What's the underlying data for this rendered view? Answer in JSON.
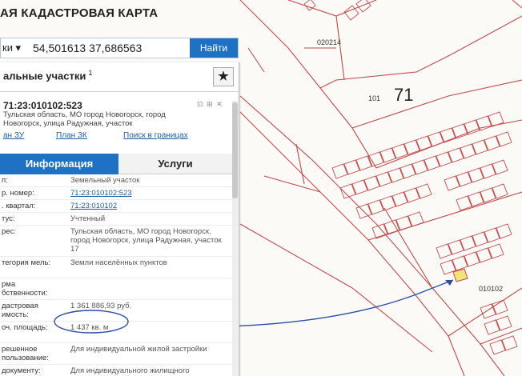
{
  "app": {
    "title": "АЯ КАДАСТРОВАЯ КАРТА"
  },
  "search": {
    "type_label": "ки ▾",
    "value": "54,501613 37,686563",
    "button_label": "Найти"
  },
  "panel": {
    "header_title": "альные участки",
    "header_sup": "1",
    "star_glyph": "★",
    "parcel_number": "71:23:010102:523",
    "tools_glyphs": "⊡ ⊞ ✕",
    "address": "Тульская область, МО город Новогорск, город Новогорск, улица Радужная, участок",
    "links": {
      "first": "ан ЗУ",
      "second": "План ЗК",
      "third": "Поиск в границах"
    },
    "tabs": {
      "info": "Информация",
      "services": "Услуги"
    },
    "rows": [
      {
        "label": "п:",
        "value": "Земельный участок"
      },
      {
        "label": "р. номер:",
        "value": "71:23:010102:523",
        "link": true
      },
      {
        "label": ". квартал:",
        "value": "71:23:010102",
        "link": true
      },
      {
        "label": "тус:",
        "value": "Учтенный"
      },
      {
        "label": "рес:",
        "value": "Тульская область, МО город Новогорск, город Новогорск, улица Радужная, участок 17"
      },
      {
        "label": "тегория мель:",
        "value": "Земли населённых пунктов"
      },
      {
        "label": "рма бственности:",
        "value": ""
      },
      {
        "label": "дастровая имость:",
        "value": "1 361 886,93 руб."
      },
      {
        "label": "оч. площадь:",
        "value": "1 437 кв. м"
      },
      {
        "label": "решенное пользование:",
        "value": "Для индивидуальной жилой застройки"
      },
      {
        "label": "документу:",
        "value": "Для индивидуального жилищного строительства"
      }
    ]
  },
  "map": {
    "labels": {
      "block_number": "71",
      "parcel_a": "020214",
      "parcel_b": "101",
      "parcel_c": "010102"
    }
  }
}
